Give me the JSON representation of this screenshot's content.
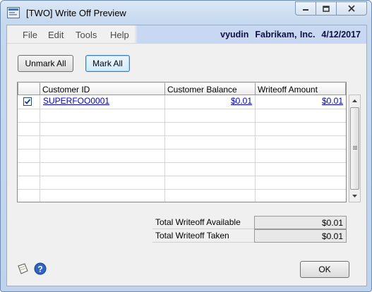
{
  "window": {
    "title": "[TWO] Write Off Preview"
  },
  "menu": {
    "items": [
      "File",
      "Edit",
      "Tools",
      "Help"
    ]
  },
  "status": {
    "user": "vyudin",
    "company": "Fabrikam, Inc.",
    "date": "4/12/2017"
  },
  "buttons": {
    "unmark_all": "Unmark All",
    "mark_all": "Mark All",
    "ok": "OK"
  },
  "grid": {
    "columns": [
      "Customer ID",
      "Customer Balance",
      "Writeoff Amount"
    ],
    "rows": [
      {
        "checked": true,
        "customer_id": "SUPERFOO0001",
        "balance": "$0.01",
        "writeoff": "$0.01"
      }
    ],
    "empty_rows": 7
  },
  "totals": {
    "available_label": "Total Writeoff Available",
    "available_value": "$0.01",
    "taken_label": "Total Writeoff Taken",
    "taken_value": "$0.01"
  },
  "icons": {
    "app": "app-window-icon",
    "note": "note-icon",
    "help": "help-icon"
  }
}
